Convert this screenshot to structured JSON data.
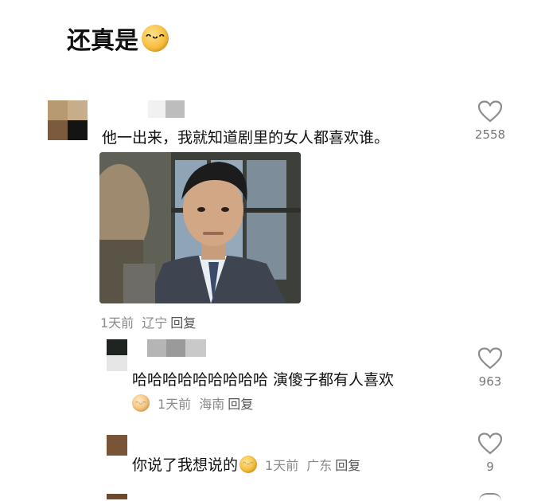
{
  "post": {
    "title": "还真是",
    "title_emoji": "laughing-emoji"
  },
  "comments": [
    {
      "text": "他一出来，我就知道剧里的女人都喜欢谁。",
      "time": "1天前",
      "location": "辽宁",
      "reply_label": "回复",
      "likes": "2558",
      "has_image": true
    }
  ],
  "replies": [
    {
      "text": "哈哈哈哈哈哈哈哈哈 演傻子都有人喜欢",
      "time": "1天前",
      "location": "海南",
      "reply_label": "回复",
      "likes": "963",
      "emoji": "crying-laughing-emoji"
    },
    {
      "text": "你说了我想说的",
      "time": "1天前",
      "location": "广东",
      "reply_label": "回复",
      "likes": "9",
      "emoji": "laughing-emoji"
    }
  ],
  "colors": {
    "background": "#ffffff",
    "text": "#111111",
    "meta": "#8a8a8a",
    "like_outline": "#8c8c8c"
  }
}
